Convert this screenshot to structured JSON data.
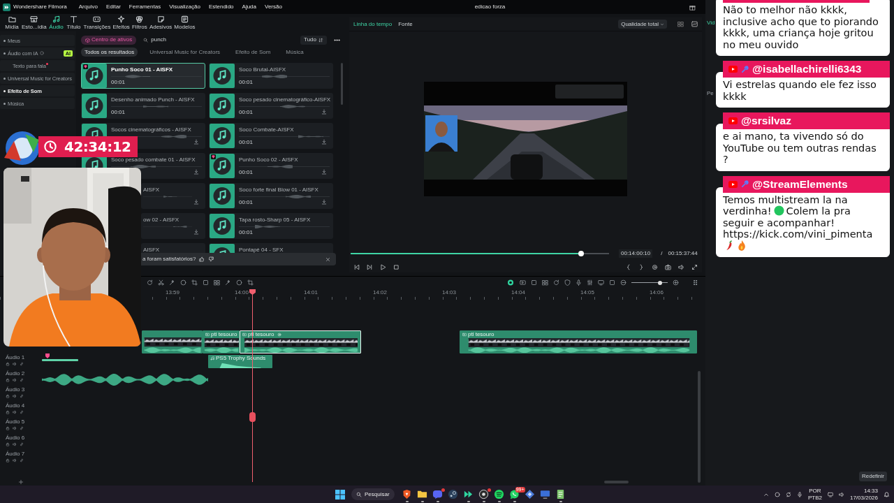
{
  "title_bar": {
    "app_name": "Wondershare Filmora",
    "menus": [
      "Arquivo",
      "Editar",
      "Ferramentas",
      "Visualização",
      "Estendido",
      "Ajuda",
      "Versão"
    ],
    "project": "edicao forza"
  },
  "toolbar": [
    {
      "label": "Mídia",
      "selected": false
    },
    {
      "label": "Esto...ídia",
      "selected": false
    },
    {
      "label": "Áudio",
      "selected": true
    },
    {
      "label": "Título",
      "selected": false
    },
    {
      "label": "Transições",
      "selected": false
    },
    {
      "label": "Efeitos",
      "selected": false
    },
    {
      "label": "Filtros",
      "selected": false
    },
    {
      "label": "Adesivos",
      "selected": false
    },
    {
      "label": "Modelos",
      "selected": false
    }
  ],
  "sidebar": {
    "items": [
      {
        "label": "Meus",
        "selected": false
      },
      {
        "label": "Áudio com IA",
        "selected": false,
        "badge": "AI",
        "children": [
          {
            "label": "Texto para fala",
            "selected": false,
            "new": true
          }
        ]
      },
      {
        "label": "Universal Music for Creators",
        "selected": false
      },
      {
        "label": "Efeito de Som",
        "selected": true
      },
      {
        "label": "Música",
        "selected": false
      }
    ]
  },
  "assets": {
    "hub_button": "Centro de ativos",
    "search": {
      "value": "punch"
    },
    "filter": "Tudo",
    "tabs": [
      {
        "label": "Todos os resultados",
        "selected": true
      },
      {
        "label": "Universal Music for Creators",
        "selected": false
      },
      {
        "label": "Efeito de Som",
        "selected": false
      },
      {
        "label": "Música",
        "selected": false
      }
    ],
    "cards": [
      {
        "title": "Punho Soco 01 - AISFX",
        "duration": "00:01",
        "selected": true,
        "premium": true,
        "download": false,
        "covered": false
      },
      {
        "title": "Soco Brutal-AISFX",
        "duration": "00:01",
        "selected": false,
        "premium": false,
        "download": false,
        "covered": false
      },
      {
        "title": "Desenho animado Punch - AISFX",
        "duration": "00:01",
        "selected": false,
        "premium": false,
        "download": false,
        "covered": false
      },
      {
        "title": "Soco pesado cinematográfico-AISFX",
        "duration": "00:01",
        "selected": false,
        "premium": false,
        "download": true,
        "covered": false
      },
      {
        "title": "Socos cinematográficos - AISFX",
        "selected": false,
        "premium": false,
        "download": true,
        "covered": false
      },
      {
        "title": "Soco Combate-AISFX",
        "duration": "00:01",
        "selected": false,
        "premium": false,
        "download": true,
        "covered": false
      },
      {
        "title": "Soco pesado combate 01 - AISFX",
        "selected": false,
        "premium": false,
        "download": true,
        "covered": false
      },
      {
        "title": "Punho Soco 02 - AISFX",
        "duration": "00:01",
        "selected": false,
        "premium": true,
        "download": true,
        "covered": false
      },
      {
        "title": "AISFX",
        "selected": false,
        "premium": false,
        "download": true,
        "covered": true
      },
      {
        "title": "Soco forte final Blow 01 - AISFX",
        "duration": "00:01",
        "selected": false,
        "premium": false,
        "download": true,
        "covered": false
      },
      {
        "title": "ow 02 - AISFX",
        "selected": false,
        "premium": false,
        "download": true,
        "covered": true
      },
      {
        "title": "Tapa rosto-Sharp 05 - AISFX",
        "duration": "00:01",
        "selected": false,
        "premium": false,
        "download": false,
        "covered": false
      },
      {
        "title": "AISFX",
        "selected": false,
        "premium": false,
        "download": false,
        "covered": true
      },
      {
        "title": "Pontapé 04 - SFX",
        "selected": false,
        "premium": false,
        "download": false,
        "covered": false
      }
    ],
    "feedback": "a foram satisfatórios?"
  },
  "player": {
    "tabs": [
      {
        "label": "Linha do tempo",
        "selected": true
      },
      {
        "label": "Fonte",
        "selected": false
      }
    ],
    "quality": "Qualidade total",
    "progress": {
      "level": 0.893
    },
    "current_time": "00:14:00:10",
    "separator": "/",
    "total_time": "00:15:37:44"
  },
  "timeline": {
    "ruler": [
      "13:59",
      "14:00",
      "14:01",
      "14:02",
      "14:03",
      "14:04",
      "14:05",
      "14:06"
    ],
    "zoom": {
      "level": 0.78
    },
    "video_clips": [
      {
        "selected": false
      },
      {
        "label": "ptl tesouro",
        "selected": false
      },
      {
        "label": "ptl tesouro",
        "selected": true
      },
      {
        "label": "ptl tesouro",
        "selected": false
      }
    ],
    "audio_clips": [
      {
        "kind": "bar"
      },
      {
        "kind": "sound",
        "label": "PS5 Trophy Sounds"
      },
      {
        "kind": "wave"
      }
    ],
    "tracks": [
      "Áudio 1",
      "Áudio 2",
      "Áudio 3",
      "Áudio 4",
      "Áudio 5",
      "Áudio 6",
      "Áudio 7"
    ]
  },
  "side_panel": {
    "tab": "Vid",
    "section": "Pe",
    "reset_button": "Redefinir"
  },
  "stream_timer": {
    "time": "42:34:12"
  },
  "chat": {
    "messages": [
      {
        "author_hidden": true,
        "text": "Não to melhor não kkkk, inclusive acho que to piorando kkkk, uma criança hoje gritou no meu ouvido"
      },
      {
        "author_hidden": false,
        "author": "@isabellachirelli6343",
        "moderator": true,
        "text": "Vi estrelas quando ele fez isso kkkk"
      },
      {
        "author_hidden": false,
        "author": "@srsilvaz",
        "moderator": false,
        "text": "e ai mano, ta vivendo só do YouTube ou tem outras rendas ?"
      },
      {
        "author_hidden": false,
        "author": "@StreamElements",
        "moderator": true,
        "lines": [
          [
            {
              "kind": "text",
              "text": "Temos multistream la na"
            }
          ],
          [
            {
              "kind": "text",
              "text": "verdinha!"
            },
            {
              "kind": "dot"
            },
            {
              "kind": "text",
              "text": "Colem la pra"
            }
          ],
          [
            {
              "kind": "text",
              "text": "seguir e acompanhar!"
            }
          ],
          [
            {
              "kind": "text",
              "text": "https://kick.com/vini_pimenta"
            }
          ],
          [
            {
              "kind": "pepper"
            },
            {
              "kind": "flame"
            }
          ]
        ]
      }
    ]
  },
  "taskbar": {
    "search": "Pesquisar",
    "apps": [
      {
        "running": true,
        "notification": false
      },
      {
        "running": true,
        "notification": false
      },
      {
        "running": true,
        "notification": true
      },
      {
        "running": false,
        "notification": false
      },
      {
        "running": true,
        "notification": false
      },
      {
        "running": true,
        "notification": true
      },
      {
        "running": true,
        "notification": false
      },
      {
        "running": true,
        "notification": false,
        "badge": "99+"
      },
      {
        "running": false,
        "notification": false
      },
      {
        "running": false,
        "notification": false
      },
      {
        "running": true,
        "notification": false
      }
    ],
    "language": "POR",
    "layout": "PTB2",
    "time": "14:33",
    "date": "17/03/2026"
  }
}
